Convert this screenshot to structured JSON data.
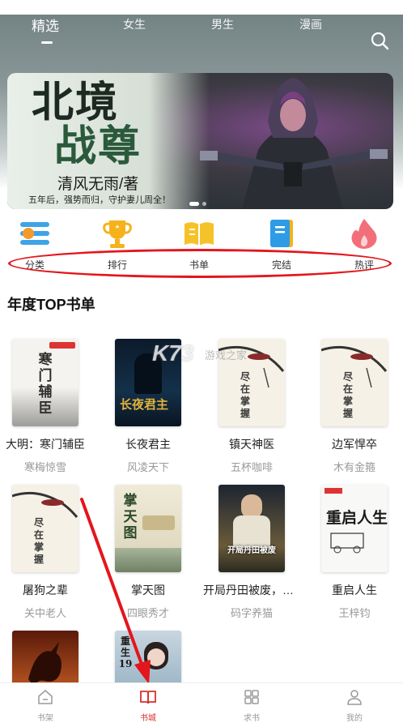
{
  "tabs": [
    {
      "label": "精选"
    },
    {
      "label": "女生"
    },
    {
      "label": "男生"
    },
    {
      "label": "漫画"
    }
  ],
  "banner": {
    "title_line1": "北境",
    "title_line2": "战尊",
    "author": "清风无雨/著",
    "tagline": "五年后，强势而归，守护妻儿周全！"
  },
  "quick_nav": [
    {
      "label": "分类",
      "icon": "category-icon"
    },
    {
      "label": "排行",
      "icon": "trophy-icon"
    },
    {
      "label": "书单",
      "icon": "book-list-icon"
    },
    {
      "label": "完结",
      "icon": "finished-book-icon"
    },
    {
      "label": "热评",
      "icon": "flame-icon"
    }
  ],
  "section": {
    "title": "年度TOP书单"
  },
  "books": [
    {
      "title": "大明：寒门辅臣",
      "author": "寒梅惊雪",
      "cover_text": "寒门辅臣"
    },
    {
      "title": "长夜君主",
      "author": "风凌天下",
      "cover_text": "长夜君主"
    },
    {
      "title": "镇天神医",
      "author": "五杯咖啡",
      "cover_text": "尽在掌握"
    },
    {
      "title": "边军悍卒",
      "author": "木有金箍",
      "cover_text": "尽在掌握"
    },
    {
      "title": "屠狗之辈",
      "author": "关中老人",
      "cover_text": "尽在掌握"
    },
    {
      "title": "掌天图",
      "author": "四眼秀才",
      "cover_text": "掌天图"
    },
    {
      "title": "开局丹田被废，我...",
      "author": "码字养猫",
      "cover_text": "开局丹田被废"
    },
    {
      "title": "重启人生",
      "author": "王梓钧",
      "cover_text": "重启人生"
    },
    {
      "title": "",
      "author": "",
      "cover_text": ""
    },
    {
      "title": "",
      "author": "",
      "cover_text": "重生19"
    }
  ],
  "watermark": {
    "logo": "K73",
    "sub": "游戏之家"
  },
  "bottom_nav": [
    {
      "label": "书架",
      "icon": "bookshelf-icon"
    },
    {
      "label": "书城",
      "icon": "bookstore-icon"
    },
    {
      "label": "求书",
      "icon": "request-book-icon"
    },
    {
      "label": "我的",
      "icon": "profile-icon"
    }
  ],
  "colors": {
    "accent": "#d8312b",
    "annotation": "#e3161c",
    "header": "#7b8a8b"
  }
}
